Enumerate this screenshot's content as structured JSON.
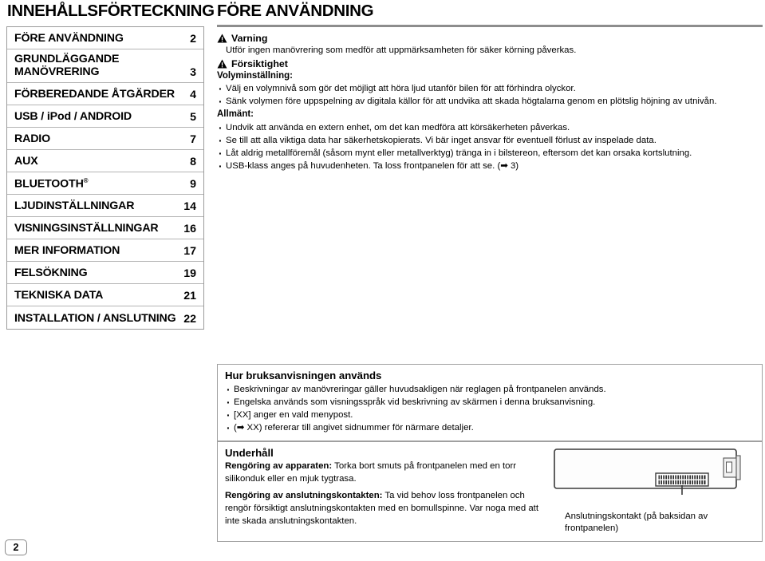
{
  "page_number": "2",
  "toc": {
    "title": "INNEHÅLLSFÖRTECKNING",
    "entries": [
      {
        "label": "FÖRE ANVÄNDNING",
        "page": "2"
      },
      {
        "label": "GRUNDLÄGGANDE MANÖVRERING",
        "page": "3"
      },
      {
        "label": "FÖRBEREDANDE ÅTGÄRDER",
        "page": "4"
      },
      {
        "label": "USB / iPod / ANDROID",
        "page": "5"
      },
      {
        "label": "RADIO",
        "page": "7"
      },
      {
        "label": "AUX",
        "page": "8"
      },
      {
        "label": "BLUETOOTH",
        "page": "9",
        "superscript": "®"
      },
      {
        "label": "LJUDINSTÄLLNINGAR",
        "page": "14"
      },
      {
        "label": "VISNINGSINSTÄLLNINGAR",
        "page": "16"
      },
      {
        "label": "MER INFORMATION",
        "page": "17"
      },
      {
        "label": "FELSÖKNING",
        "page": "19"
      },
      {
        "label": "TEKNISKA DATA",
        "page": "21"
      },
      {
        "label": "INSTALLATION / ANSLUTNING",
        "page": "22"
      }
    ]
  },
  "main": {
    "title": "FÖRE ANVÄNDNING",
    "warning": {
      "icon": "warning-triangle-icon",
      "heading": "Varning",
      "body": "Utför ingen manövrering som medför att uppmärksamheten för säker körning påverkas."
    },
    "caution": {
      "icon": "caution-triangle-icon",
      "heading": "Försiktighet",
      "volume_subhead": "Volyminställning:",
      "volume_bullets": [
        "Välj en volymnivå som gör det möjligt att höra ljud utanför bilen för att förhindra olyckor.",
        "Sänk volymen före uppspelning av digitala källor för att undvika att skada högtalarna genom en plötslig höjning av utnivån."
      ],
      "general_subhead": "Allmänt:",
      "general_bullets": [
        "Undvik att använda en extern enhet, om det kan medföra att körsäkerheten påverkas.",
        "Se till att alla viktiga data har säkerhetskopierats. Vi bär inget ansvar för eventuell förlust av inspelade data.",
        "Låt aldrig metallföremål (såsom mynt eller metallverktyg) tränga in i bilstereon, eftersom det kan orsaka kortslutning.",
        "USB-klass anges på huvudenheten. Ta loss frontpanelen för att se. (➡ 3)"
      ]
    },
    "howto": {
      "title": "Hur bruksanvisningen används",
      "bullets": [
        "Beskrivningar av manövreringar gäller huvudsakligen när reglagen på frontpanelen används.",
        "Engelska används som visningsspråk vid beskrivning av skärmen i denna bruksanvisning.",
        "[XX] anger en vald menypost.",
        "(➡ XX) refererar till angivet sidnummer för närmare detaljer."
      ]
    },
    "maintenance": {
      "title": "Underhåll",
      "paragraphs": [
        {
          "lead": "Rengöring av apparaten:",
          "text": " Torka bort smuts på frontpanelen med en torr silikonduk eller en mjuk tygtrasa."
        },
        {
          "lead": "Rengöring av anslutningskontakten:",
          "text": " Ta vid behov loss frontpanelen och rengör försiktigt anslutningskontakten med en bomullspinne. Var noga med att inte skada anslutningskontakten."
        }
      ],
      "figure": {
        "name": "front-panel-rear-illustration",
        "caption": "Anslutningskontakt (på baksidan av frontpanelen)"
      }
    }
  }
}
